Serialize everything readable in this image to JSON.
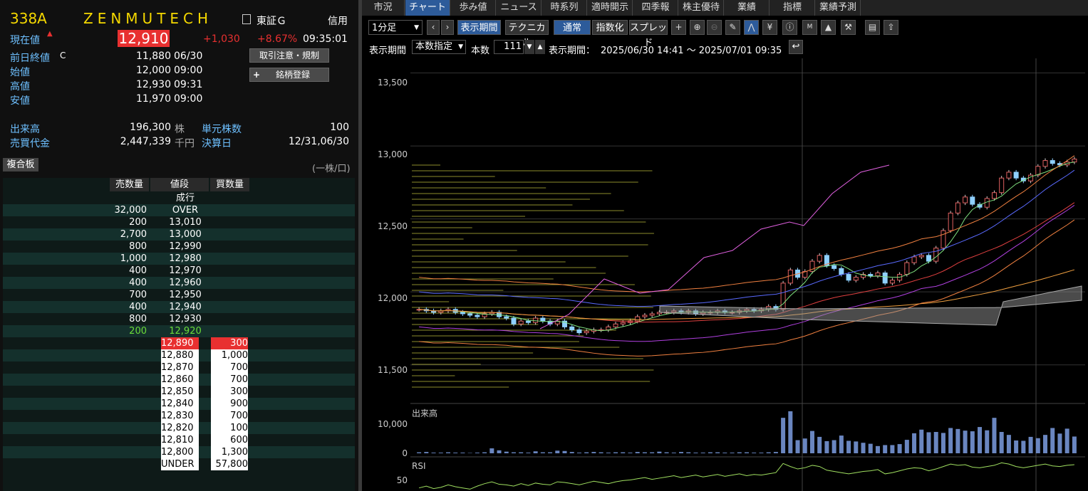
{
  "stock": {
    "code": "338A",
    "name": "ZENMUTECH",
    "market": "東証Ｇ",
    "margin": "信用"
  },
  "price": {
    "label": "現在値",
    "value": "12,910",
    "change": "+1,030",
    "pct": "+8.67%",
    "time": "09:35:01",
    "up_color": "#e83030"
  },
  "details": [
    {
      "label": "前日終値",
      "flag": "C",
      "value": "11,880",
      "time": "06/30"
    },
    {
      "label": "始値",
      "flag": "",
      "value": "12,000",
      "time": "09:00"
    },
    {
      "label": "高値",
      "flag": "",
      "value": "12,930",
      "time": "09:31"
    },
    {
      "label": "安値",
      "flag": "",
      "value": "11,970",
      "time": "09:00"
    }
  ],
  "buttons": {
    "caution": "取引注意・規制",
    "register": "銘柄登録"
  },
  "volume": {
    "label": "出来高",
    "value": "196,300",
    "unit": "株",
    "unit_label": "単元株数",
    "unit_value": "100"
  },
  "turnover": {
    "label": "売買代金",
    "value": "2,447,339",
    "unit": "千円",
    "settle_label": "決算日",
    "settle_value": "12/31,06/30"
  },
  "board": {
    "tab": "複合板",
    "note": "(一株/口)",
    "headers": [
      "売数量",
      "値段",
      "買数量"
    ],
    "rows": [
      {
        "sell": "",
        "price": "成行",
        "buy": ""
      },
      {
        "sell": "32,000",
        "price": "OVER",
        "buy": ""
      },
      {
        "sell": "200",
        "price": "13,010",
        "buy": ""
      },
      {
        "sell": "2,700",
        "price": "13,000",
        "buy": ""
      },
      {
        "sell": "800",
        "price": "12,990",
        "buy": ""
      },
      {
        "sell": "1,000",
        "price": "12,980",
        "buy": ""
      },
      {
        "sell": "400",
        "price": "12,970",
        "buy": ""
      },
      {
        "sell": "400",
        "price": "12,960",
        "buy": ""
      },
      {
        "sell": "700",
        "price": "12,950",
        "buy": ""
      },
      {
        "sell": "400",
        "price": "12,940",
        "buy": ""
      },
      {
        "sell": "800",
        "price": "12,930",
        "buy": ""
      },
      {
        "sell": "200",
        "price": "12,920",
        "buy": ""
      },
      {
        "sell": "",
        "price": "12,890",
        "buy": "300"
      },
      {
        "sell": "",
        "price": "12,880",
        "buy": "1,000"
      },
      {
        "sell": "",
        "price": "12,870",
        "buy": "700"
      },
      {
        "sell": "",
        "price": "12,860",
        "buy": "700"
      },
      {
        "sell": "",
        "price": "12,850",
        "buy": "300"
      },
      {
        "sell": "",
        "price": "12,840",
        "buy": "900"
      },
      {
        "sell": "",
        "price": "12,830",
        "buy": "700"
      },
      {
        "sell": "",
        "price": "12,820",
        "buy": "100"
      },
      {
        "sell": "",
        "price": "12,810",
        "buy": "600"
      },
      {
        "sell": "",
        "price": "12,800",
        "buy": "1,300"
      },
      {
        "sell": "",
        "price": "UNDER",
        "buy": "57,800"
      }
    ]
  },
  "tabs": [
    "市況",
    "チャート",
    "歩み値",
    "ニュース",
    "時系列",
    "適時開示",
    "四季報",
    "株主優待",
    "業績",
    "指標",
    "業績予測"
  ],
  "toolbar": {
    "interval": "1分足",
    "period_btn": "表示期間",
    "tech_btn": "テクニカル",
    "normal_btn": "通常",
    "index_btn": "指数化",
    "spread_btn": "スプレッド"
  },
  "periodbar": {
    "label": "表示期間",
    "mode": "本数指定",
    "count_label": "本数",
    "count": "111",
    "range_label": "表示期間：",
    "range": "2025/06/30 14:41 ～ 2025/07/01 09:35"
  },
  "chart": {
    "y_labels": [
      "13,500",
      "13,000",
      "12,500",
      "12,000",
      "11,500"
    ],
    "vol_label": "出来高",
    "vol_tick": "10,000",
    "vol_zero": "0",
    "rsi_label": "RSI",
    "rsi_tick": "50"
  },
  "chart_data": {
    "type": "candlestick",
    "ylim": [
      11250,
      13600
    ],
    "closes": [
      11880,
      11870,
      11860,
      11870,
      11880,
      11860,
      11850,
      11840,
      11830,
      11850,
      11860,
      11830,
      11820,
      11780,
      11800,
      11790,
      11820,
      11800,
      11780,
      11800,
      11760,
      11740,
      11720,
      11730,
      11740,
      11740,
      11760,
      11780,
      11790,
      11800,
      11830,
      11840,
      11850,
      11860,
      11860,
      11870,
      11860,
      11870,
      11850,
      11860,
      11860,
      11870,
      11860,
      11860,
      11870,
      11880,
      11870,
      11880,
      11900,
      11880,
      12060,
      12150,
      12100,
      12140,
      12210,
      12250,
      12180,
      12160,
      12120,
      12080,
      12100,
      12120,
      12110,
      12130,
      12060,
      12080,
      12120,
      12200,
      12240,
      12250,
      12210,
      12300,
      12420,
      12540,
      12610,
      12650,
      12600,
      12580,
      12640,
      12680,
      12780,
      12820,
      12780,
      12760,
      12800,
      12860,
      12900,
      12880,
      12870,
      12890,
      12910
    ],
    "volumes": [
      300,
      400,
      200,
      200,
      300,
      200,
      200,
      100,
      200,
      300,
      1500,
      900,
      500,
      300,
      300,
      200,
      600,
      300,
      300,
      800,
      700,
      400,
      200,
      300,
      400,
      300,
      200,
      300,
      300,
      200,
      400,
      300,
      300,
      500,
      300,
      200,
      400,
      300,
      200,
      200,
      300,
      300,
      200,
      200,
      300,
      300,
      200,
      200,
      300,
      400,
      10800,
      12800,
      4000,
      4500,
      6800,
      5000,
      3700,
      4000,
      5400,
      3800,
      3600,
      3200,
      2900,
      2200,
      2500,
      2500,
      2800,
      4100,
      6100,
      7200,
      6400,
      6500,
      6200,
      7700,
      7400,
      6900,
      6700,
      8000,
      7000,
      10800,
      6500,
      5600,
      3900,
      3800,
      5000,
      4600,
      5600,
      7700,
      6000,
      7500,
      5100
    ],
    "volume_ylim": [
      0,
      13000
    ],
    "rsi": [
      35,
      38,
      34,
      36,
      40,
      37,
      35,
      33,
      38,
      42,
      45,
      41,
      40,
      38,
      42,
      39,
      43,
      41,
      40,
      45,
      44,
      42,
      40,
      43,
      46,
      44,
      42,
      45,
      47,
      48,
      50,
      52,
      49,
      51,
      53,
      55,
      52,
      54,
      56,
      53,
      55,
      57,
      54,
      56,
      58,
      55,
      57,
      56,
      58,
      60,
      75,
      70,
      66,
      68,
      72,
      70,
      64,
      62,
      60,
      58,
      60,
      62,
      63,
      65,
      58,
      60,
      63,
      66,
      68,
      67,
      63,
      66,
      70,
      74,
      72,
      73,
      69,
      68,
      70,
      72,
      76,
      74,
      70,
      68,
      70,
      72,
      74,
      71,
      70,
      72,
      73
    ],
    "rsi_ylim": [
      30,
      80
    ]
  }
}
